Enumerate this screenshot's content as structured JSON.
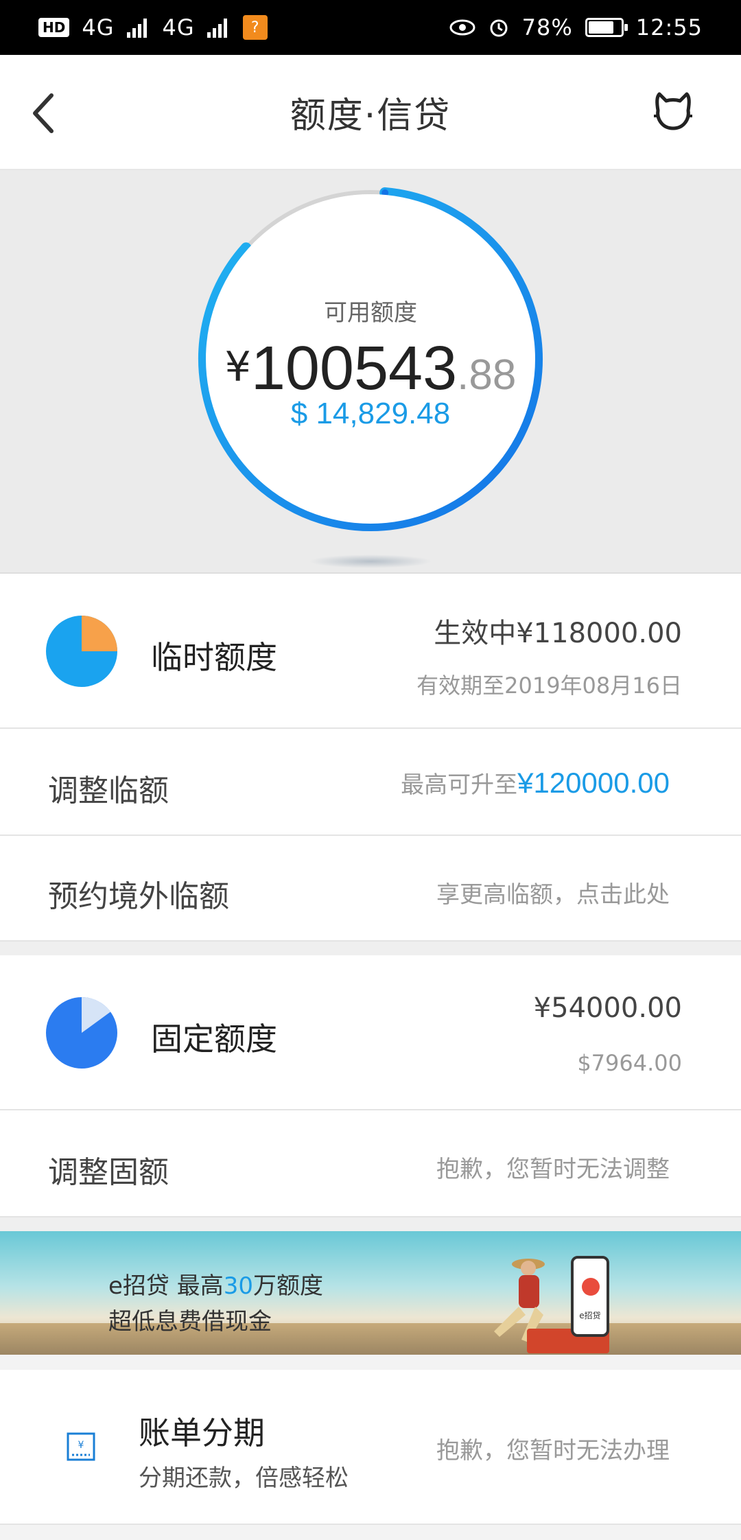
{
  "status_bar": {
    "left_badge": "HD",
    "signal_1": "4G",
    "signal_2": "4G",
    "battery_percent": "78%",
    "battery_level": 0.78,
    "time": "12:55"
  },
  "nav": {
    "title": "额度·信贷",
    "back_icon": "chevron-left-icon",
    "service_icon": "cat-service-icon"
  },
  "available": {
    "label": "可用额度",
    "currency": "¥",
    "amount_integer": "100543",
    "amount_decimal": ".88",
    "usd": "$ 14,829.48",
    "ring_fraction": 0.852,
    "ring_color": "#1a9be6"
  },
  "temporary": {
    "title": "临时额度",
    "status_amount": "生效中¥118000.00",
    "valid_until": "有效期至2019年08月16日",
    "pie_fraction": 0.25,
    "pie_colors": [
      "#1aa3ef",
      "#f7a14a"
    ]
  },
  "adjust_temp": {
    "title": "调整临额",
    "hint_prefix": "最高可升至",
    "hint_amount": "¥120000.00"
  },
  "reserve_overseas": {
    "title": "预约境外临额",
    "hint": "享更高临额，点击此处"
  },
  "fixed": {
    "title": "固定额度",
    "amount_cny": "¥54000.00",
    "amount_usd": "$7964.00",
    "pie_fraction": 0.15,
    "pie_colors": [
      "#2b7cf0",
      "#d6e4f7"
    ]
  },
  "adjust_fixed": {
    "title": "调整固额",
    "hint": "抱歉，您暂时无法调整"
  },
  "banner": {
    "line1_prefix": "e招贷  最高",
    "line1_highlight": "30",
    "line1_suffix": "万额度",
    "line2": "超低息费借现金",
    "phone_caption": "e招贷"
  },
  "installment": {
    "title": "账单分期",
    "subtitle": "分期还款，倍感轻松",
    "hint": "抱歉，您暂时无法办理",
    "icon": "bill-icon",
    "icon_glyph": "¥"
  }
}
